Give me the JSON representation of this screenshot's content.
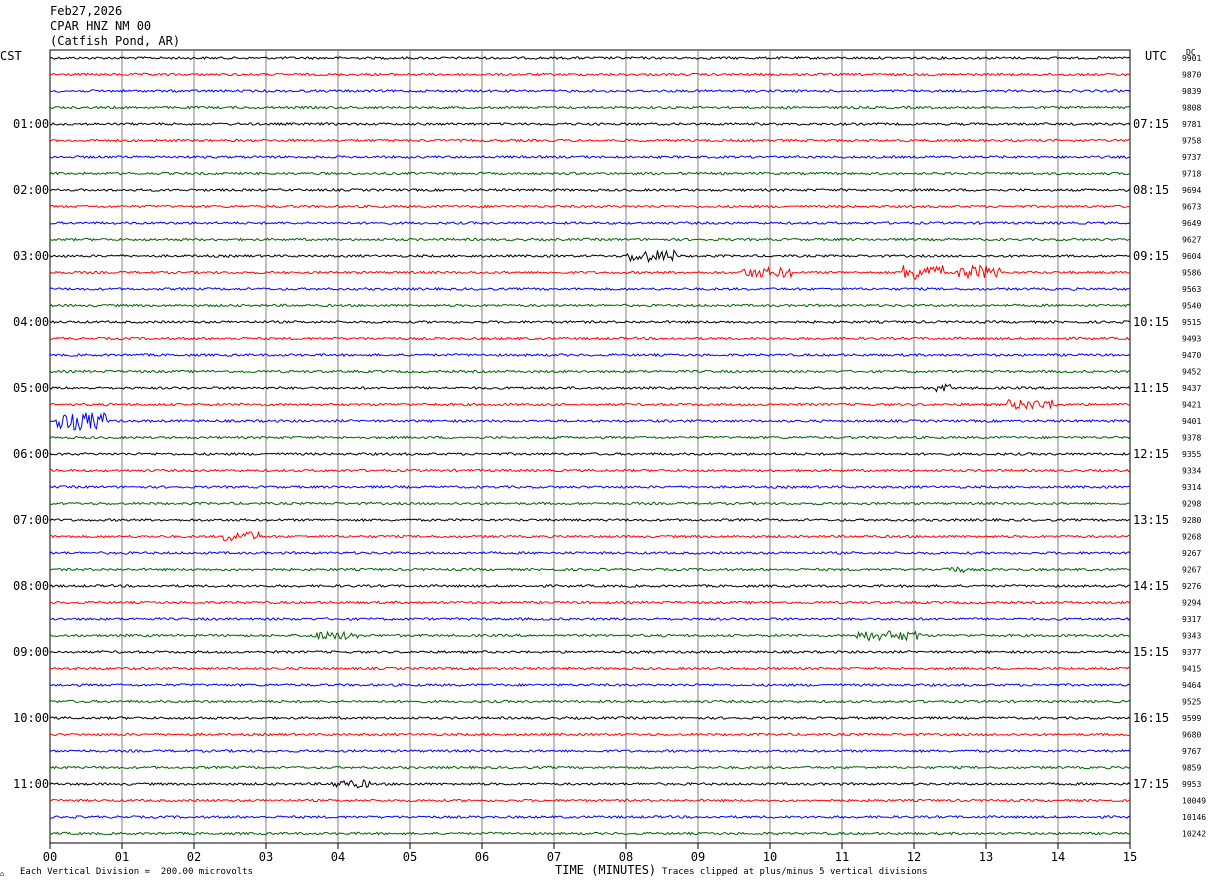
{
  "header": {
    "date": "Feb27,2026",
    "station": "CPAR HNZ NM 00",
    "location": "(Catfish Pond, AR)"
  },
  "axes": {
    "left_timezone": "CST",
    "right_timezone": "UTC",
    "dc_header": "DC"
  },
  "footer": {
    "scale_note": "Each Vertical Division =  200.00 microvolts",
    "xlabel": "TIME (MINUTES)",
    "clip_note": "Traces clipped at plus/minus 5 vertical divisions",
    "logo_mark": "⌂"
  },
  "colors": {
    "trace_cycle": [
      "#000000",
      "#ff0000",
      "#0000ff",
      "#006400"
    ],
    "grid": "#808080",
    "background": "#ffffff"
  },
  "chart_data": {
    "type": "line",
    "subtype": "helicorder",
    "x_unit": "minutes",
    "xlim": [
      0,
      15
    ],
    "x_ticks": [
      "00",
      "01",
      "02",
      "03",
      "04",
      "05",
      "06",
      "07",
      "08",
      "09",
      "10",
      "11",
      "12",
      "13",
      "14",
      "15"
    ],
    "minutes_per_line": 15,
    "line_count": 48,
    "left_hour_labels": [
      "01:00",
      "02:00",
      "03:00",
      "04:00",
      "05:00",
      "06:00",
      "07:00",
      "08:00",
      "09:00",
      "10:00",
      "11:00"
    ],
    "right_hour_labels": [
      "07:15",
      "08:15",
      "09:15",
      "10:15",
      "11:15",
      "12:15",
      "13:15",
      "14:15",
      "15:15",
      "16:15",
      "17:15"
    ],
    "hour_label_first_line": 4,
    "hour_label_every_n_lines": 4,
    "dc_values": [
      "9901",
      "9870",
      "9839",
      "9808",
      "9781",
      "9758",
      "9737",
      "9718",
      "9694",
      "9673",
      "9649",
      "9627",
      "9604",
      "9586",
      "9563",
      "9540",
      "9515",
      "9493",
      "9470",
      "9452",
      "9437",
      "9421",
      "9401",
      "9378",
      "9355",
      "9334",
      "9314",
      "9298",
      "9280",
      "9268",
      "9267",
      "9267",
      "9276",
      "9294",
      "9317",
      "9343",
      "9377",
      "9415",
      "9464",
      "9525",
      "9599",
      "9680",
      "9767",
      "9859",
      "9953",
      "10049",
      "10146",
      "10242"
    ],
    "events": [
      {
        "line": 12,
        "start_min": 8.0,
        "end_min": 8.7,
        "amp": 6
      },
      {
        "line": 13,
        "start_min": 9.6,
        "end_min": 10.3,
        "amp": 5
      },
      {
        "line": 13,
        "start_min": 11.8,
        "end_min": 12.4,
        "amp": 8
      },
      {
        "line": 13,
        "start_min": 12.6,
        "end_min": 13.2,
        "amp": 7
      },
      {
        "line": 20,
        "start_min": 12.3,
        "end_min": 12.5,
        "amp": 4
      },
      {
        "line": 21,
        "start_min": 13.3,
        "end_min": 14.0,
        "amp": 5
      },
      {
        "line": 22,
        "start_min": 0.1,
        "end_min": 0.8,
        "amp": 9
      },
      {
        "line": 29,
        "start_min": 2.4,
        "end_min": 2.9,
        "amp": 5
      },
      {
        "line": 31,
        "start_min": 12.4,
        "end_min": 12.7,
        "amp": 3
      },
      {
        "line": 35,
        "start_min": 3.6,
        "end_min": 4.3,
        "amp": 4
      },
      {
        "line": 35,
        "start_min": 11.2,
        "end_min": 12.1,
        "amp": 5
      },
      {
        "line": 44,
        "start_min": 3.9,
        "end_min": 4.5,
        "amp": 4
      }
    ]
  }
}
